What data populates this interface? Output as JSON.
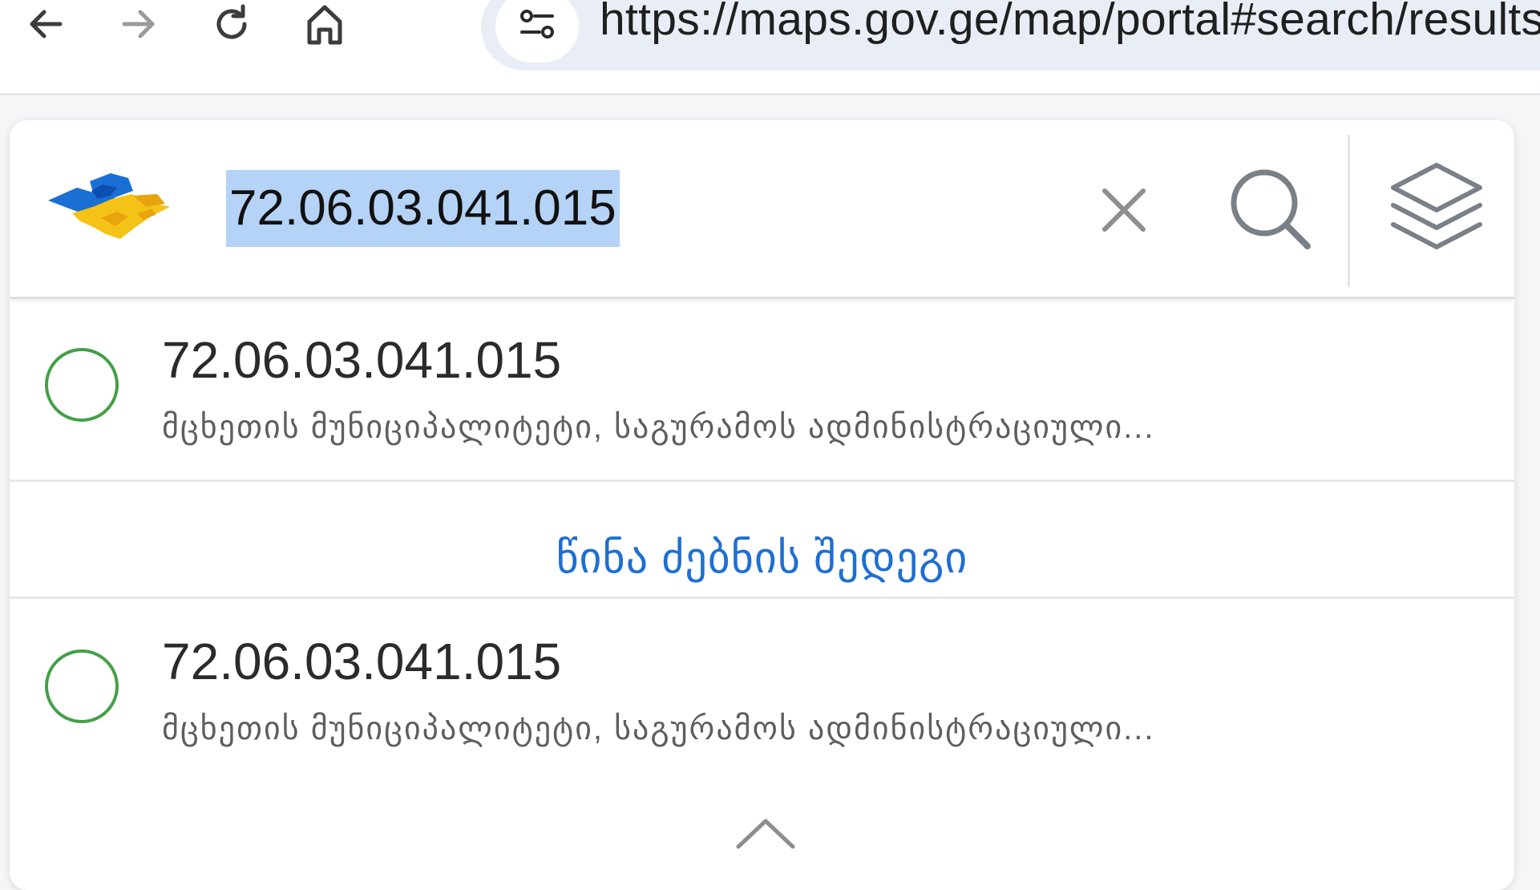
{
  "browser": {
    "url": "https://maps.gov.ge/map/portal#search/results",
    "icons": {
      "back": "arrow-left-icon",
      "forward": "arrow-right-icon",
      "reload": "reload-icon",
      "home": "home-icon",
      "site_info": "tune-icon"
    }
  },
  "search": {
    "value": "72.06.03.041.015",
    "placeholder": "",
    "icons": {
      "clear": "close-icon",
      "search": "search-icon",
      "layers": "layers-icon"
    }
  },
  "results": [
    {
      "title": "72.06.03.041.015",
      "subtitle": "მცხეთის მუნიციპალიტეტი, საგურამოს ადმინისტრაციული..."
    },
    {
      "title": "72.06.03.041.015",
      "subtitle": "მცხეთის მუნიციპალიტეტი, საგურამოს ადმინისტრაციული..."
    }
  ],
  "prev_results_link": "წინა ძებნის შედეგი",
  "colors": {
    "accent": "#1e6fd1",
    "result_ring": "#43a047",
    "selection": "#b4d3f7",
    "logo_blue": "#1a6fd4",
    "logo_yellow": "#f5c218"
  }
}
